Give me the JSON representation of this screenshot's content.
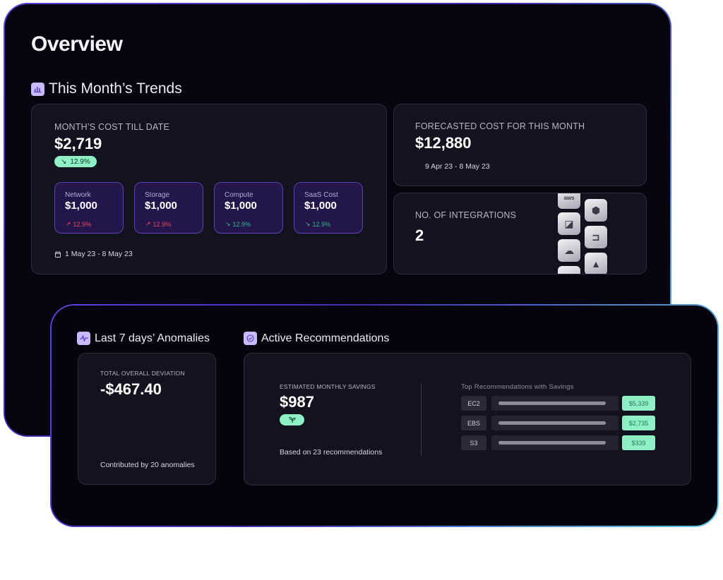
{
  "overview": {
    "title": "Overview",
    "trends_section": "This Month’s Trends",
    "month_cost": {
      "label": "MONTH’S COST TILL DATE",
      "value": "$2,719",
      "delta": "12.9%",
      "delta_icon": "↘",
      "date_range": "1 May 23 - 8 May 23",
      "breakdown": [
        {
          "label": "Network",
          "value": "$1,000",
          "delta": "12.9%",
          "direction": "up",
          "arrow": "↗"
        },
        {
          "label": "Storage",
          "value": "$1,000",
          "delta": "12.9%",
          "direction": "up",
          "arrow": "↗"
        },
        {
          "label": "Compute",
          "value": "$1,000",
          "delta": "12.9%",
          "direction": "down",
          "arrow": "↘"
        },
        {
          "label": "SaaS Cost",
          "value": "$1,000",
          "delta": "12.9%",
          "direction": "down",
          "arrow": "↘"
        }
      ]
    },
    "forecast": {
      "label": "FORECASTED COST FOR THIS MONTH",
      "value": "$12,880",
      "date_range": "9 Apr 23 - 8 May 23"
    },
    "integrations": {
      "label": "NO. OF INTEGRATIONS",
      "value": "2",
      "icons": [
        "aws-icon",
        "hexagon-icon",
        "cube-icon",
        "chip-icon",
        "cloud-icon",
        "triangle-icon"
      ]
    }
  },
  "anomalies": {
    "section": "Last 7 days’ Anomalies",
    "label": "TOTAL OVERALL DEVIATION",
    "value": "-$467.40",
    "footer": "Contributed by 20 anomalies"
  },
  "recommendations": {
    "section": "Active Recommendations",
    "savings_label": "ESTIMATED MONTHLY SAVINGS",
    "savings_value": "$987",
    "footer": "Based on 23 recommendations",
    "top_label": "Top Recommendations with Savings",
    "items": [
      {
        "service": "EC2",
        "amount": "$5,339",
        "share": 1.0
      },
      {
        "service": "EBS",
        "amount": "$2,735",
        "share": 1.0
      },
      {
        "service": "S3",
        "amount": "$339",
        "share": 1.0
      }
    ]
  },
  "colors": {
    "accent": "#6b4fe0",
    "positive": "#8ef0c4",
    "negative": "#e74a5b",
    "card": "#13121f"
  }
}
